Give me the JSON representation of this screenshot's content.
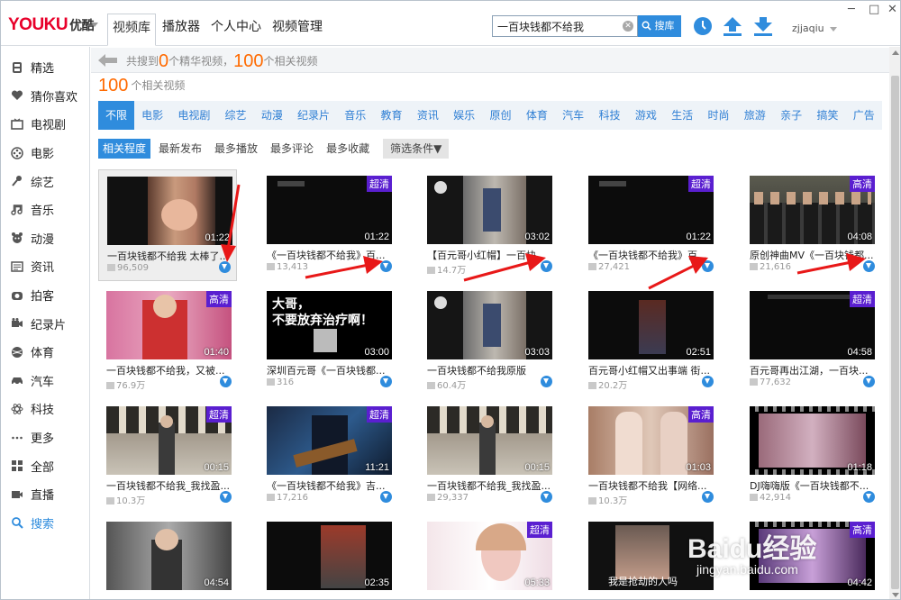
{
  "app": {
    "logo_text": "YOUKU",
    "logo_cn": "优酷",
    "nav": [
      "视频库",
      "播放器",
      "个人中心",
      "视频管理"
    ],
    "active_nav": 0,
    "search": {
      "value": "一百块钱都不给我",
      "button": "搜库"
    },
    "user": "zjjaqiu",
    "window_controls": [
      "─",
      "□",
      "✕"
    ]
  },
  "sidebar": {
    "items": [
      {
        "label": "精选",
        "icon": "featured-icon"
      },
      {
        "label": "猜你喜欢",
        "icon": "heart-icon"
      },
      {
        "label": "电视剧",
        "icon": "tv-icon"
      },
      {
        "label": "电影",
        "icon": "film-reel-icon"
      },
      {
        "label": "综艺",
        "icon": "microphone-icon"
      },
      {
        "label": "音乐",
        "icon": "music-note-icon"
      },
      {
        "label": "动漫",
        "icon": "cartoon-icon"
      },
      {
        "label": "资讯",
        "icon": "news-icon"
      },
      {
        "label": "拍客",
        "icon": "camera-icon"
      },
      {
        "label": "纪录片",
        "icon": "video-camera-icon"
      },
      {
        "label": "体育",
        "icon": "ball-icon"
      },
      {
        "label": "汽车",
        "icon": "car-icon"
      },
      {
        "label": "科技",
        "icon": "atom-icon"
      },
      {
        "label": "更多",
        "icon": "more-icon"
      },
      {
        "label": "全部",
        "icon": "grid-icon"
      },
      {
        "label": "直播",
        "icon": "live-icon"
      },
      {
        "label": "搜索",
        "icon": "search-icon"
      }
    ],
    "active_index": 16
  },
  "results": {
    "prefix": "共搜到",
    "featured_count": "0",
    "featured_label": "个精华视频，",
    "related_count": "100",
    "related_label": "个相关视频",
    "line2_count": "100",
    "line2_label": "个相关视频"
  },
  "categories": [
    "不限",
    "电影",
    "电视剧",
    "综艺",
    "动漫",
    "纪录片",
    "音乐",
    "教育",
    "资讯",
    "娱乐",
    "原创",
    "体育",
    "汽车",
    "科技",
    "游戏",
    "生活",
    "时尚",
    "旅游",
    "亲子",
    "搞笑",
    "广告"
  ],
  "active_category": 0,
  "sorts": [
    "相关程度",
    "最新发布",
    "最多播放",
    "最多评论",
    "最多收藏"
  ],
  "active_sort": 0,
  "filter_label": "筛选条件▼",
  "videos": [
    {
      "title": "一百块钱都不给我 太棒了...",
      "duration": "01:22",
      "plays": "96,509",
      "badge": "",
      "scene": "face",
      "selected": true
    },
    {
      "title": "《一百块钱都不给我》百...",
      "duration": "01:22",
      "plays": "13,413",
      "badge": "超清",
      "scene": "dark"
    },
    {
      "title": "【百元哥小红帽】一百块...",
      "duration": "03:02",
      "plays": "14.7万",
      "badge": "",
      "scene": "street"
    },
    {
      "title": "《一百块钱都不给我》百...",
      "duration": "01:22",
      "plays": "27,421",
      "badge": "超清",
      "scene": "dark"
    },
    {
      "title": "原创神曲MV《一百块钱都...",
      "duration": "04:08",
      "plays": "21,616",
      "badge": "高清",
      "scene": "group"
    },
    {
      "title": "一百块钱都不给我，又被...",
      "duration": "01:40",
      "plays": "76.9万",
      "badge": "高清",
      "scene": "pink"
    },
    {
      "title": "深圳百元哥《一百块钱都...",
      "duration": "03:00",
      "plays": "316",
      "badge": "",
      "scene": "text",
      "overlay": "大哥，\n不要放弃治疗啊！"
    },
    {
      "title": "一百块钱都不给我原版",
      "duration": "03:03",
      "plays": "60.4万",
      "badge": "",
      "scene": "street"
    },
    {
      "title": "百元哥小红帽又出事端 街...",
      "duration": "02:51",
      "plays": "20.2万",
      "badge": "",
      "scene": "dark2"
    },
    {
      "title": "百元哥再出江湖，一百块...",
      "duration": "04:58",
      "plays": "77,632",
      "badge": "超清",
      "scene": "black"
    },
    {
      "title": "一百块钱都不给我_我找盈...",
      "duration": "00:15",
      "plays": "10.3万",
      "badge": "超清",
      "scene": "office"
    },
    {
      "title": "《一百块钱都不给我》吉...",
      "duration": "11:21",
      "plays": "17,216",
      "badge": "超清",
      "scene": "guitar"
    },
    {
      "title": "一百块钱都不给我_我找盈...",
      "duration": "00:15",
      "plays": "29,337",
      "badge": "",
      "scene": "office"
    },
    {
      "title": "一百块钱都不给我【网络...",
      "duration": "01:03",
      "plays": "10.3万",
      "badge": "高清",
      "scene": "girls"
    },
    {
      "title": "DJ嗨嗨版《一百块钱都不...",
      "duration": "01:18",
      "plays": "42,914",
      "badge": "",
      "scene": "film"
    },
    {
      "title": "",
      "duration": "04:54",
      "plays": "",
      "badge": "",
      "scene": "kid"
    },
    {
      "title": "",
      "duration": "02:35",
      "plays": "",
      "badge": "",
      "scene": "dark3"
    },
    {
      "title": "",
      "duration": "05:33",
      "plays": "",
      "badge": "超清",
      "scene": "girl2"
    },
    {
      "title": "",
      "duration": "",
      "plays": "",
      "badge": "",
      "scene": "face2",
      "overlay": "我是抢劫的人吗"
    },
    {
      "title": "",
      "duration": "04:42",
      "plays": "",
      "badge": "高清",
      "scene": "film2"
    }
  ],
  "watermark": {
    "main": "Baidu经验",
    "sub": "jingyan.baidu.com"
  },
  "colors": {
    "accent": "#2f8cdd",
    "orange": "#ff6a00",
    "hd_badge": "#5a1fd0",
    "arrow": "#e81818"
  }
}
